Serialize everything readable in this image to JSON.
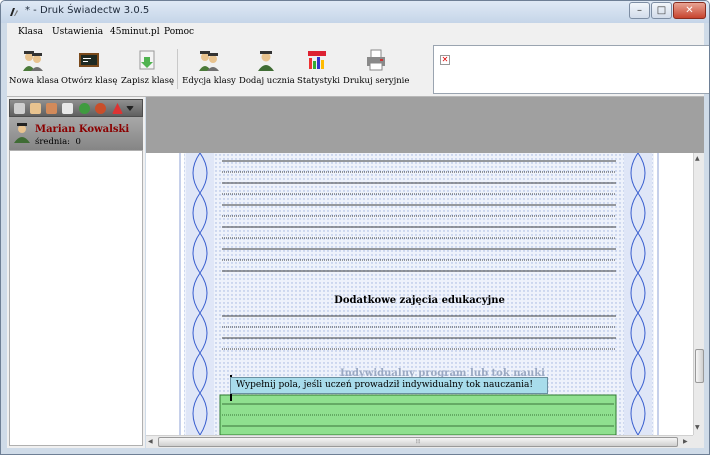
{
  "window": {
    "title": "* - Druk Świadectw 3.0.5",
    "minimize": "–",
    "maximize": "□",
    "close": "✕"
  },
  "menu": [
    "Klasa",
    "Ustawienia",
    "45minut.pl",
    "Pomoc"
  ],
  "toolbar": [
    {
      "label": "Nowa klasa",
      "icon": "new-class-icon"
    },
    {
      "label": "Otwórz klasę",
      "icon": "open-class-icon"
    },
    {
      "label": "Zapisz klasę",
      "icon": "save-class-icon"
    },
    {
      "label": "Edycja klasy",
      "icon": "edit-class-icon"
    },
    {
      "label": "Dodaj ucznia",
      "icon": "add-student-icon"
    },
    {
      "label": "Statystyki",
      "icon": "statistics-icon"
    },
    {
      "label": "Drukuj seryjnie",
      "icon": "print-serial-icon"
    }
  ],
  "ad": {
    "broken_image": "✕"
  },
  "student": {
    "name": "Marian Kowalski",
    "average_label": "średnia:",
    "average_value": "0"
  },
  "document": {
    "heading": "Dodatkowe zajęcia edukacyjne",
    "ghost_heading": "Indywidualny program lub tok nauki",
    "tooltip": "Wypełnij pola, jeśli uczeń prowadził indywidualny tok nauczania!"
  },
  "scroll": {
    "hscroll_grip": "⦙⦙⦙",
    "vscroll_up": "▲",
    "vscroll_down": "▼",
    "hscroll_left": "◀",
    "hscroll_right": "▶"
  },
  "colors": {
    "accent_name": "#8b0000",
    "tooltip": "#a8dceb",
    "green_fill": "#8fe08f",
    "pattern": "#3a5fcf"
  }
}
